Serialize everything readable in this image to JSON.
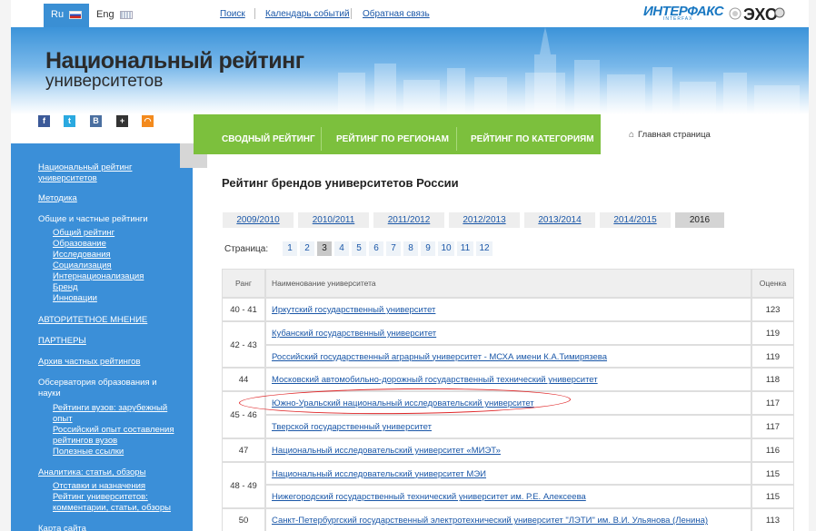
{
  "topbar": {
    "lang_ru": "Ru",
    "lang_en": "Eng",
    "links": [
      "Поиск",
      "Календарь событий",
      "Обратная связь"
    ],
    "interfax_logo": "ИНТЕРФАКС",
    "interfax_sub": "INTERFAX",
    "partner_logo": "ЭХО"
  },
  "banner": {
    "title": "Национальный рейтинг",
    "subtitle": "университетов"
  },
  "social": {
    "icons": [
      "facebook-icon",
      "twitter-icon",
      "vkontakte-icon",
      "share-plus-icon",
      "rss-icon"
    ],
    "glyphs": [
      "f",
      "t",
      "B",
      "+",
      "◠"
    ],
    "colors": [
      "#3b5998",
      "#2aa9e0",
      "#4a6fa0",
      "#333333",
      "#f38a1d"
    ]
  },
  "sidebar": {
    "items": [
      {
        "label": "Национальный рейтинг",
        "cont": "университетов",
        "link": true
      },
      {
        "label": "Методика",
        "link": true
      },
      {
        "label": "Общие и частные рейтинги",
        "link": false
      },
      {
        "label": "Общий рейтинг",
        "sub": true
      },
      {
        "label": "Образование",
        "sub": true
      },
      {
        "label": "Исследования",
        "sub": true
      },
      {
        "label": "Социализация",
        "sub": true
      },
      {
        "label": "Интернационализация",
        "sub": true
      },
      {
        "label": "Бренд",
        "sub": true
      },
      {
        "label": "Инновации",
        "sub": true
      },
      {
        "label": "АВТОРИТЕТНОЕ МНЕНИЕ",
        "link": true
      },
      {
        "label": "ПАРТНЕРЫ",
        "link": true
      },
      {
        "label": "Архив частных рейтингов",
        "link": true
      },
      {
        "label": "Обсерватория образования и",
        "cont": "науки",
        "link": false
      },
      {
        "label": "Рейтинги вузов: зарубежный",
        "cont": "опыт",
        "sub": true
      },
      {
        "label": "Российский опыт составления",
        "cont": "рейтингов вузов",
        "sub": true
      },
      {
        "label": "Полезные ссылки",
        "sub": true
      },
      {
        "label": "Аналитика: статьи, обзоры",
        "link": true
      },
      {
        "label": "Отставки и назначения",
        "sub": true
      },
      {
        "label": "Рейтинг университетов:",
        "cont": "комментарии, статьи, обзоры",
        "sub": true
      },
      {
        "label": "Карта сайта",
        "link": true
      }
    ]
  },
  "nav": {
    "items": [
      "СВОДНЫЙ РЕЙТИНГ",
      "РЕЙТИНГ ПО РЕГИОНАМ",
      "РЕЙТИНГ ПО КАТЕГОРИЯМ"
    ],
    "home": "Главная страница"
  },
  "content": {
    "title": "Рейтинг брендов университетов России",
    "years": [
      "2009/2010",
      "2010/2011",
      "2011/2012",
      "2012/2013",
      "2013/2014",
      "2014/2015",
      "2016"
    ],
    "active_year": "2016",
    "pager_label": "Страница:",
    "pages": [
      "1",
      "2",
      "3",
      "4",
      "5",
      "6",
      "7",
      "8",
      "9",
      "10",
      "11",
      "12"
    ],
    "active_page": "3"
  },
  "table": {
    "headers": [
      "Ранг",
      "Наименование университета",
      "Оценка"
    ],
    "groups": [
      {
        "rank": "40 - 41",
        "rows": [
          {
            "name": "Иркутский государственный университет",
            "score": "123"
          }
        ]
      },
      {
        "rank": "42 - 43",
        "rows": [
          {
            "name": "Кубанский государственный университет",
            "score": "119"
          },
          {
            "name": "Российский государственный аграрный университет - МСХА имени К.А.Тимирязева",
            "score": "119"
          }
        ]
      },
      {
        "rank": "44",
        "rows": [
          {
            "name": "Московский автомобильно-дорожный государственный технический университет",
            "score": "118"
          }
        ]
      },
      {
        "rank": "45 - 46",
        "rows": [
          {
            "name": "Южно-Уральский национальный исследовательский университет",
            "score": "117"
          },
          {
            "name": "Тверской государственный университет",
            "score": "117"
          }
        ]
      },
      {
        "rank": "47",
        "rows": [
          {
            "name": "Национальный исследовательский университет «МИЭТ»",
            "score": "116"
          }
        ]
      },
      {
        "rank": "48 - 49",
        "rows": [
          {
            "name": "Национальный исследовательский университет МЭИ",
            "score": "115"
          },
          {
            "name": "Нижегородский государственный технический университет им. Р.Е. Алексеева",
            "score": "115"
          }
        ]
      },
      {
        "rank": "50",
        "rows": [
          {
            "name": "Санкт-Петербургский государственный электротехнический университет \"ЛЭТИ\" им. В.И. Ульянова (Ленина)",
            "score": "113"
          }
        ]
      }
    ]
  },
  "colors": {
    "sidebar": "#3b8fd8",
    "nav": "#7cc03d",
    "link": "#1a57a8",
    "highlight": "#e0282a"
  }
}
